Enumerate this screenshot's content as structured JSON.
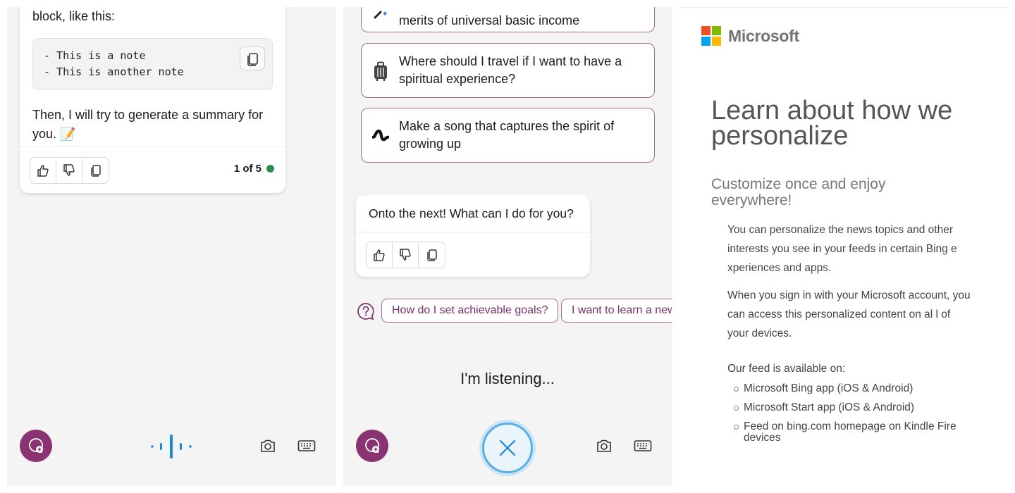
{
  "panel1": {
    "message": {
      "intro": "block, like this:",
      "code_lines": [
        "- This is a note",
        "- This is another note"
      ],
      "outro_line1": "Then, I will try to generate a summary for",
      "outro_line2": "you. 📝",
      "pager": "1 of 5"
    },
    "icons": [
      "thumbs-up-icon",
      "thumbs-down-icon",
      "copy-icon",
      "new-topic-icon",
      "voice-wave-icon",
      "camera-icon",
      "keyboard-icon"
    ],
    "colors": {
      "accent": "#8a3372",
      "voice": "#1e88d6",
      "status_green": "#2f8a4e"
    }
  },
  "panel2": {
    "suggestions": [
      {
        "text": "merits of universal basic income",
        "icon": "magic-wand-icon"
      },
      {
        "text": "Where should I travel if I want to have a spiritual experience?",
        "icon": "luggage-icon"
      },
      {
        "text": "Make a song that captures the spirit of growing up",
        "icon": "music-wave-icon"
      }
    ],
    "reply": "Onto the next! What can I do for you?",
    "chips": [
      "How do I set achievable goals?",
      "I want to learn a new"
    ],
    "status": "I'm listening...",
    "icons": [
      "question-icon",
      "stop-icon",
      "camera-icon",
      "keyboard-icon"
    ]
  },
  "panel3": {
    "brand": "Microsoft",
    "heading": "Learn about how we personalize",
    "subheading": "Customize once and enjoy everywhere!",
    "paragraph1": "You can personalize the news topics and other interests you see in your feeds in certain Bing e xperiences and apps.",
    "paragraph2": "When you sign in with your Microsoft account, you can access this personalized content on al l of your devices.",
    "available_label": "Our feed is available on:",
    "platforms": [
      "Microsoft Bing app (iOS & Android)",
      "Microsoft Start app (iOS & Android)",
      "Feed on bing.com homepage on Kindle Fire devices"
    ],
    "logo_colors": [
      "#f25022",
      "#7fba00",
      "#00a4ef",
      "#ffb900"
    ]
  }
}
